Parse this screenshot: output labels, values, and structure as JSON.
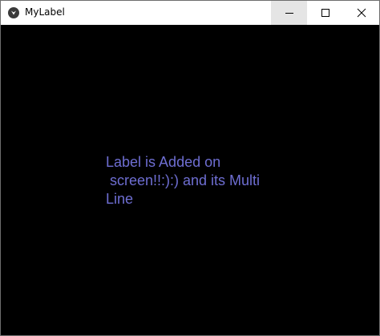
{
  "window": {
    "title": "MyLabel"
  },
  "content": {
    "label_text": "Label is Added on\n screen!!:):) and its Multi\nLine",
    "label_color": "#6e6ed2",
    "background_color": "#000000"
  },
  "icons": {
    "app": "kivy-app-icon",
    "minimize": "minimize-icon",
    "maximize": "maximize-icon",
    "close": "close-icon"
  }
}
